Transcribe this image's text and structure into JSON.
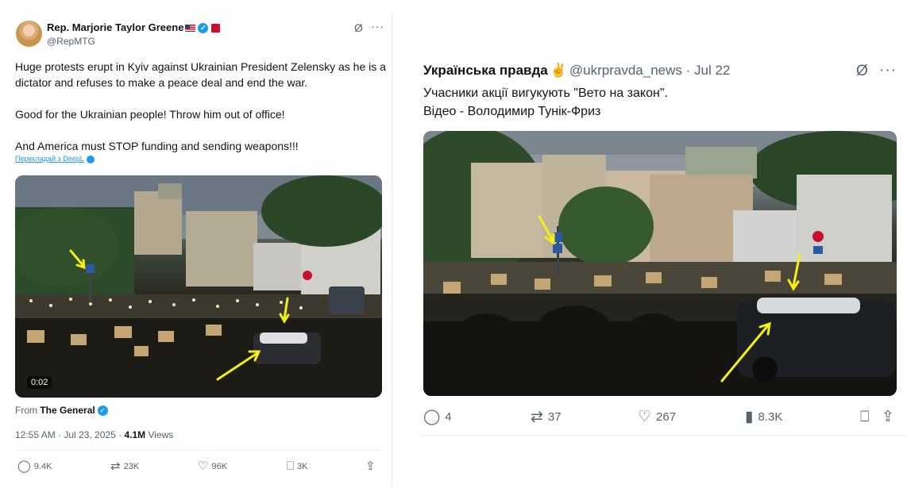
{
  "left_tweet": {
    "author_name": "Rep. Marjorie Taylor Greene",
    "handle": "@RepMTG",
    "text": "Huge protests erupt in Kyiv against Ukrainian President Zelensky as he is a dictator and refuses to make a peace deal and end the war.\n\nGood for the Ukrainian people! Throw him out of office!\n\nAnd America must STOP funding and sending weapons!!!",
    "translate_link": "Перекладай з DeepL",
    "video_time": "0:02",
    "from_label": "From",
    "from_source": "The General",
    "timestamp": "12:55 AM · Jul 23, 2025 ·",
    "views_count": "4.1M",
    "views_label": "Views",
    "actions": {
      "replies": "9.4K",
      "reposts": "23K",
      "likes": "96K",
      "bookmarks": "3K"
    }
  },
  "right_tweet": {
    "author_name": "Українська правда",
    "handle": "@ukrpravda_news",
    "date": "· Jul 22",
    "text": "Учасники акції вигукують \"Вето на закон\".\nВідео - Володимир Тунік-Фриз",
    "actions": {
      "replies": "4",
      "reposts": "37",
      "likes": "267",
      "views": "8.3K"
    }
  },
  "icons": {
    "reply": "speech-bubble-icon",
    "repost": "repost-arrows-icon",
    "like": "heart-icon",
    "views": "bar-chart-icon",
    "bookmark": "bookmark-icon",
    "share": "share-upload-icon",
    "grok": "grok-icon",
    "more": "more-dots-icon",
    "verified": "verified-badge-icon"
  },
  "colors": {
    "accent": "#1d9bf0",
    "muted_text": "#536471",
    "annotation_arrow": "#f4ee1a"
  }
}
